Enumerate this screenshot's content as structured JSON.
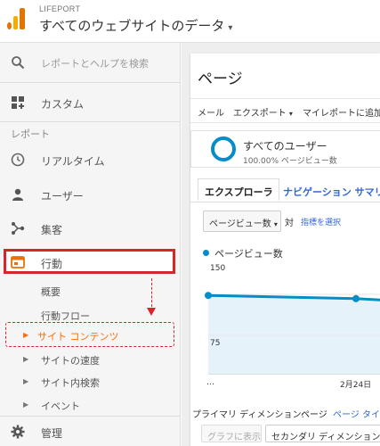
{
  "header": {
    "app_name": "LIFEPORT",
    "property": "すべてのウェブサイトのデータ",
    "property_caret": "▾"
  },
  "sidebar": {
    "search_placeholder": "レポートとヘルプを検索",
    "customization": "カスタム",
    "reports_section": "レポート",
    "items": [
      {
        "label": "リアルタイム",
        "icon": "clock-icon"
      },
      {
        "label": "ユーザー",
        "icon": "person-icon"
      },
      {
        "label": "集客",
        "icon": "acquisition-icon"
      },
      {
        "label": "行動",
        "icon": "behavior-icon"
      }
    ],
    "behavior_sub": [
      {
        "label": "概要"
      },
      {
        "label": "行動フロー"
      },
      {
        "label": "サイト コンテンツ",
        "highlight_color": "#ff6d00"
      },
      {
        "label": "サイトの速度"
      },
      {
        "label": "サイト内検索"
      },
      {
        "label": "イベント"
      }
    ],
    "admin": "管理"
  },
  "main": {
    "title": "ページ",
    "toolbar": {
      "mail": "メール",
      "export": "エクスポート",
      "export_caret": "▾",
      "add_to_dashboard": "マイレポートに追加"
    },
    "segment": {
      "name": "すべてのユーザー",
      "sub": "100.00% ページビュー数"
    },
    "tabs": {
      "explorer": "エクスプローラ",
      "navigation": "ナビゲーション サマリー"
    },
    "metric_selector": "ページビュー数",
    "metric_selector_caret": "▾",
    "vs_label": "対",
    "pick_metric": "指標を選択",
    "legend": "ページビュー数",
    "primary_dimension_label": "プライマリ ディメンション:",
    "primary_dimension_current": "ページ",
    "primary_dimension_alt": "ページ タイト",
    "graph_button": "グラフに表示",
    "secondary_dimension": "セカンダリ ディメンション",
    "secondary_caret": "▾"
  },
  "chart_data": {
    "type": "area",
    "series": [
      {
        "name": "ページビュー数",
        "values": [
          148,
          142,
          137
        ]
      }
    ],
    "y_ticks": [
      "150",
      "75"
    ],
    "x_ticks": [
      "…",
      "2月24日"
    ],
    "ylim": [
      0,
      150
    ],
    "colors": {
      "line": "#058dc7",
      "fill": "#e6f2f9"
    }
  },
  "colors": {
    "accent_red": "#d4262b",
    "active_sub": "#ff6d00",
    "link_blue": "#3367d6"
  }
}
